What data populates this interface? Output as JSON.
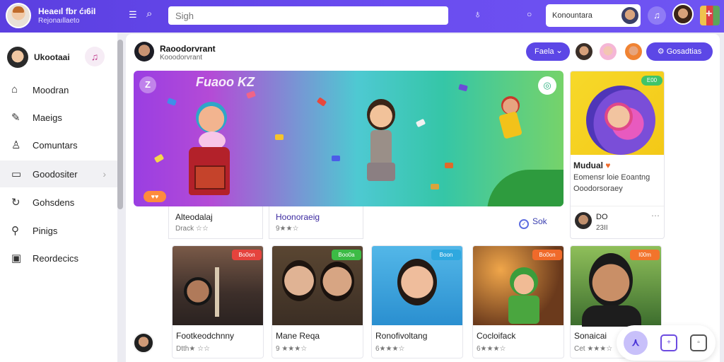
{
  "header": {
    "app_title": "Heaeıl fbr ćı6iI",
    "app_subtitle": "Rejonaıllaeto",
    "search_placeholder": "Sigh",
    "community_label": "Konountara"
  },
  "sidebar": {
    "user_name": "Ukootaai",
    "items": [
      {
        "label": "Moodran",
        "icon": "home-icon"
      },
      {
        "label": "Maeigs",
        "icon": "pencil-icon"
      },
      {
        "label": "Comuntars",
        "icon": "person-icon"
      },
      {
        "label": "Goodositer",
        "icon": "library-icon",
        "active": true
      },
      {
        "label": "Gohsdens",
        "icon": "refresh-icon"
      },
      {
        "label": "Pinigs",
        "icon": "pin-icon"
      },
      {
        "label": "Reordecics",
        "icon": "calendar-icon"
      }
    ]
  },
  "channel": {
    "name": "Raoodorvrant",
    "subtitle": "Kooodorvrant",
    "feed_label": "Faela",
    "settings_label": "Gosadtias"
  },
  "hero": {
    "title": "Fuaoo KZ",
    "badge": "Z",
    "likes": "♥♥"
  },
  "info_cards": [
    {
      "title": "Alteodalaj",
      "sub": "Drack ☆☆"
    },
    {
      "title": "Hoonoraeig",
      "sub": "9★★☆"
    }
  ],
  "sort_label": "Sok",
  "side_card": {
    "tag": "E00",
    "title": "Mudual",
    "line1": "Eomensr loie Eoantng",
    "line2": "Ooodorsoraey",
    "author": "DO",
    "meta": "23II"
  },
  "videos": [
    {
      "tag": "Bo0on",
      "title": "Footkeodchnny",
      "sub": "Dtth★ ☆☆",
      "tag_color": "#e5433d"
    },
    {
      "tag": "Boo0a",
      "title": "Mane Reqa",
      "sub": "9 ★★★☆",
      "tag_color": "#3cbb45"
    },
    {
      "tag": "Boon",
      "title": "Ronofivoltang",
      "sub": "6★★★☆",
      "tag_color": "#2fa8df"
    },
    {
      "tag": "Bo0on",
      "title": "Cocloifack",
      "sub": "6★★★☆",
      "tag_color": "#f06a2a"
    },
    {
      "tag": "I00m",
      "title": "Sonaicai",
      "sub": "Cet ★★★☆",
      "tag_color": "#f2742c"
    }
  ]
}
